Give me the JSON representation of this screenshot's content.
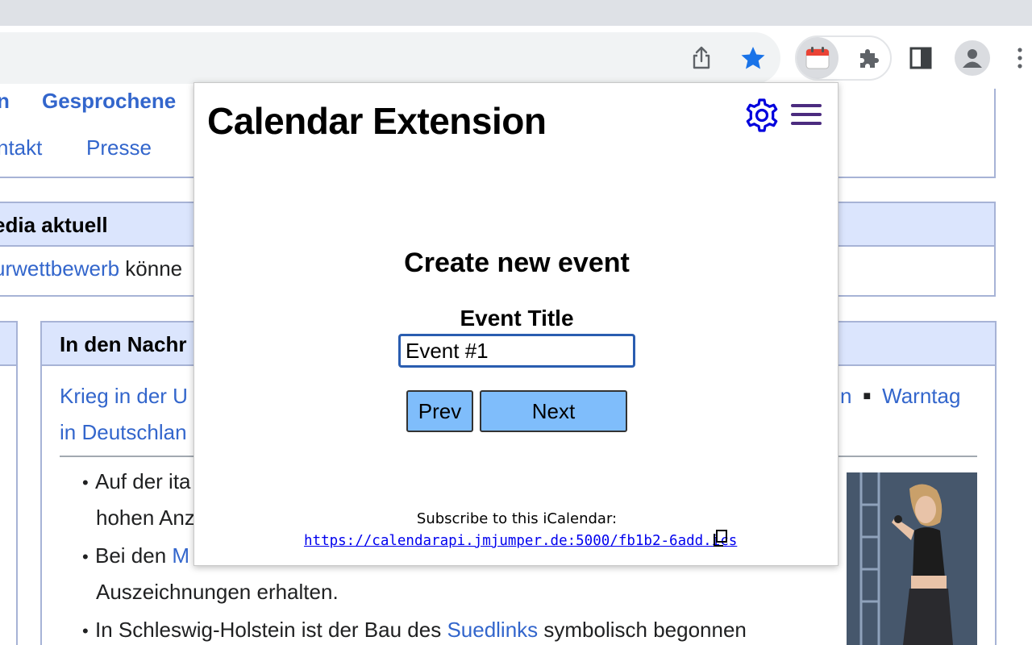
{
  "browser": {
    "toolbar_icons": [
      "share-icon",
      "bookmark-star-icon",
      "calendar-extension-icon",
      "extensions-puzzle-icon",
      "side-panel-icon",
      "profile-icon",
      "more-menu-icon"
    ],
    "colors": {
      "star": "#1a73e8",
      "tabstrip": "#dee1e6"
    }
  },
  "wiki": {
    "spoken_left": "n",
    "spoken": "Gesprochene",
    "kontakt": "ntakt",
    "presse": "Presse",
    "aktuell_title": "edia aktuell",
    "aktuell_link": "urwettbewerb",
    "aktuell_rest": " könne",
    "news_title": "In den Nachr",
    "news_line1": "Krieg in der U",
    "news_line1_right_a": "n",
    "news_line1_right_b": "Warntag",
    "news_line2": "in Deutschlan",
    "bullet1_a": "Auf der ita",
    "bullet1_b": "hohen Anz",
    "bullet2_a": "Bei den ",
    "bullet2_link": "M",
    "bullet2_b": "Auszeichnungen erhalten.",
    "bullet3_a": "In Schleswig-Holstein ist der Bau des ",
    "bullet3_link": "Suedlinks",
    "bullet3_b": " symbolisch begonnen"
  },
  "popup": {
    "title": "Calendar Extension",
    "create_title": "Create new event",
    "event_title_label": "Event Title",
    "event_title_value": "Event #1",
    "prev_label": "Prev",
    "next_label": "Next",
    "subscribe_label": "Subscribe to this iCalendar:",
    "subscribe_url": "https://calendarapi.jmjumper.de:5000/fb1b2-6add.ics",
    "colors": {
      "gear": "#0000dd",
      "menu": "#4b2b7f",
      "button": "#7fbdfb",
      "input_border": "#2a5db0",
      "link": "#0000ee"
    }
  }
}
